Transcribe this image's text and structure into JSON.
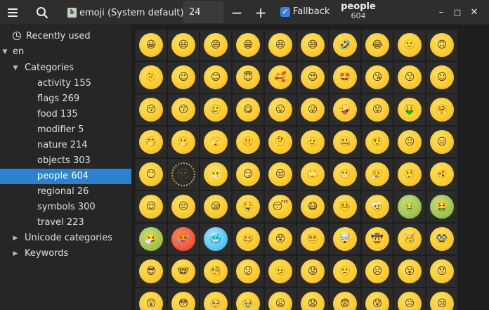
{
  "header": {
    "font_label": "emoji (System default)",
    "font_icon": "b",
    "size_value": "24",
    "fallback_label": "Fallback",
    "page_title": "people",
    "page_count": "604"
  },
  "sidebar": {
    "recently_used": "Recently used",
    "locale": "en",
    "categories_label": "Categories",
    "categories": [
      {
        "label": "activity 155"
      },
      {
        "label": "flags 269"
      },
      {
        "label": "food 135"
      },
      {
        "label": "modifier 5"
      },
      {
        "label": "nature 214"
      },
      {
        "label": "objects 303"
      },
      {
        "label": "people 604"
      },
      {
        "label": "regional 26"
      },
      {
        "label": "symbols 300"
      },
      {
        "label": "travel 223"
      }
    ],
    "unicode_categories": "Unicode categories",
    "keywords": "Keywords"
  },
  "colors": {
    "accent": "#2a83d1",
    "checkbox": "#3584e4"
  },
  "emoji_rows": [
    [
      "😀",
      "😃",
      "😄",
      "😁",
      "😆",
      "😅",
      "🤣",
      "😂",
      "🙂",
      "🙃"
    ],
    [
      "🫠",
      "😉",
      "😊",
      "😇",
      "🥰",
      "😍",
      "🤩",
      "😘",
      "😗",
      "☺"
    ],
    [
      "😚",
      "😙",
      "🥲",
      "😋",
      "😛",
      "😜",
      "🤪",
      "😝",
      "🤑",
      "🤗"
    ],
    [
      "🤭",
      "🫢",
      "🫣",
      "🤫",
      "🤔",
      "🫡",
      "🤐",
      "🤨",
      "😐",
      "😑"
    ],
    [
      "😶",
      "🫥",
      "😶‍🌫️",
      "😏",
      "😒",
      "🙄",
      "😬",
      "😮‍💨",
      "🤥",
      "🫨"
    ],
    [
      "😌",
      "😔",
      "😪",
      "🤤",
      "😴",
      "😷",
      "🤒",
      "🤕",
      "🤢",
      "🤮"
    ],
    [
      "🤧",
      "🥵",
      "🥶",
      "🥴",
      "😵",
      "😵‍💫",
      "🤯",
      "🤠",
      "🥳",
      "🥸"
    ],
    [
      "😎",
      "🤓",
      "🧐",
      "😕",
      "🫤",
      "😟",
      "🙁",
      "☹",
      "😮",
      "😯"
    ],
    [
      "😲",
      "😳",
      "🥺",
      "🥹",
      "😦",
      "😧",
      "😨",
      "😰",
      "😥",
      "😢"
    ]
  ]
}
